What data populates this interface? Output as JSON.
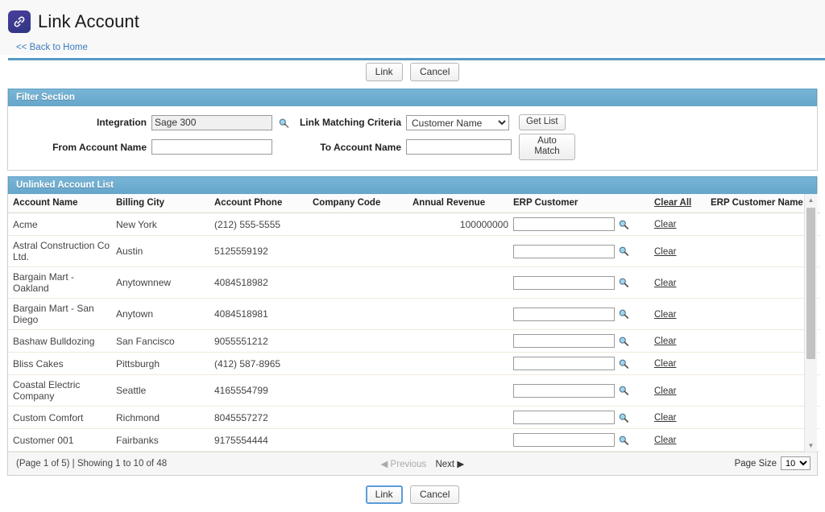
{
  "header": {
    "title": "Link Account",
    "icon": "link-chain-icon",
    "back_link": "<< Back to Home"
  },
  "toolbar": {
    "link_label": "Link",
    "cancel_label": "Cancel"
  },
  "filter": {
    "section_title": "Filter Section",
    "integration_label": "Integration",
    "integration_value": "Sage 300",
    "from_account_label": "From Account Name",
    "from_account_value": "",
    "link_criteria_label": "Link Matching Criteria",
    "link_criteria_value": "Customer Name",
    "link_criteria_options": [
      "Customer Name"
    ],
    "to_account_label": "To Account Name",
    "to_account_value": "",
    "get_list_label": "Get List",
    "auto_match_label": "Auto Match",
    "lookup_icon": "magnifier-lookup-icon"
  },
  "list": {
    "section_title": "Unlinked Account List",
    "columns": [
      "Account Name",
      "Billing City",
      "Account Phone",
      "Company Code",
      "Annual Revenue",
      "ERP Customer",
      "Clear All",
      "ERP Customer Name"
    ],
    "clear_all_label": "Clear All",
    "clear_row_label": "Clear",
    "erp_lookup_icon": "magnifier-lookup-icon",
    "rows": [
      {
        "account_name": "Acme",
        "billing_city": "New York",
        "account_phone": "(212) 555-5555",
        "company_code": "",
        "annual_revenue": "100000000",
        "erp_customer": "",
        "erp_customer_name": ""
      },
      {
        "account_name": "Astral Construction Co Ltd.",
        "billing_city": "Austin",
        "account_phone": "5125559192",
        "company_code": "",
        "annual_revenue": "",
        "erp_customer": "",
        "erp_customer_name": ""
      },
      {
        "account_name": "Bargain Mart - Oakland",
        "billing_city": "Anytownnew",
        "account_phone": "4084518982",
        "company_code": "",
        "annual_revenue": "",
        "erp_customer": "",
        "erp_customer_name": ""
      },
      {
        "account_name": "Bargain Mart - San Diego",
        "billing_city": "Anytown",
        "account_phone": "4084518981",
        "company_code": "",
        "annual_revenue": "",
        "erp_customer": "",
        "erp_customer_name": ""
      },
      {
        "account_name": "Bashaw Bulldozing",
        "billing_city": "San Fancisco",
        "account_phone": "9055551212",
        "company_code": "",
        "annual_revenue": "",
        "erp_customer": "",
        "erp_customer_name": ""
      },
      {
        "account_name": "Bliss Cakes",
        "billing_city": "Pittsburgh",
        "account_phone": "(412) 587-8965",
        "company_code": "",
        "annual_revenue": "",
        "erp_customer": "",
        "erp_customer_name": ""
      },
      {
        "account_name": "Coastal Electric Company",
        "billing_city": "Seattle",
        "account_phone": "4165554799",
        "company_code": "",
        "annual_revenue": "",
        "erp_customer": "",
        "erp_customer_name": ""
      },
      {
        "account_name": "Custom Comfort",
        "billing_city": "Richmond",
        "account_phone": "8045557272",
        "company_code": "",
        "annual_revenue": "",
        "erp_customer": "",
        "erp_customer_name": ""
      },
      {
        "account_name": "Customer 001",
        "billing_city": "Fairbanks",
        "account_phone": "9175554444",
        "company_code": "",
        "annual_revenue": "",
        "erp_customer": "",
        "erp_customer_name": ""
      }
    ]
  },
  "pager": {
    "info": "(Page 1 of 5) | Showing 1 to 10 of 48",
    "previous_label": "Previous",
    "next_label": "Next",
    "page_size_label": "Page Size",
    "page_size_value": "10",
    "page_size_options": [
      "10"
    ]
  },
  "colors": {
    "accent_blue": "#6fafd2",
    "rule_blue": "#579ac4",
    "link_blue": "#3b7bbf",
    "icon_purple": "#3b3d8f"
  }
}
